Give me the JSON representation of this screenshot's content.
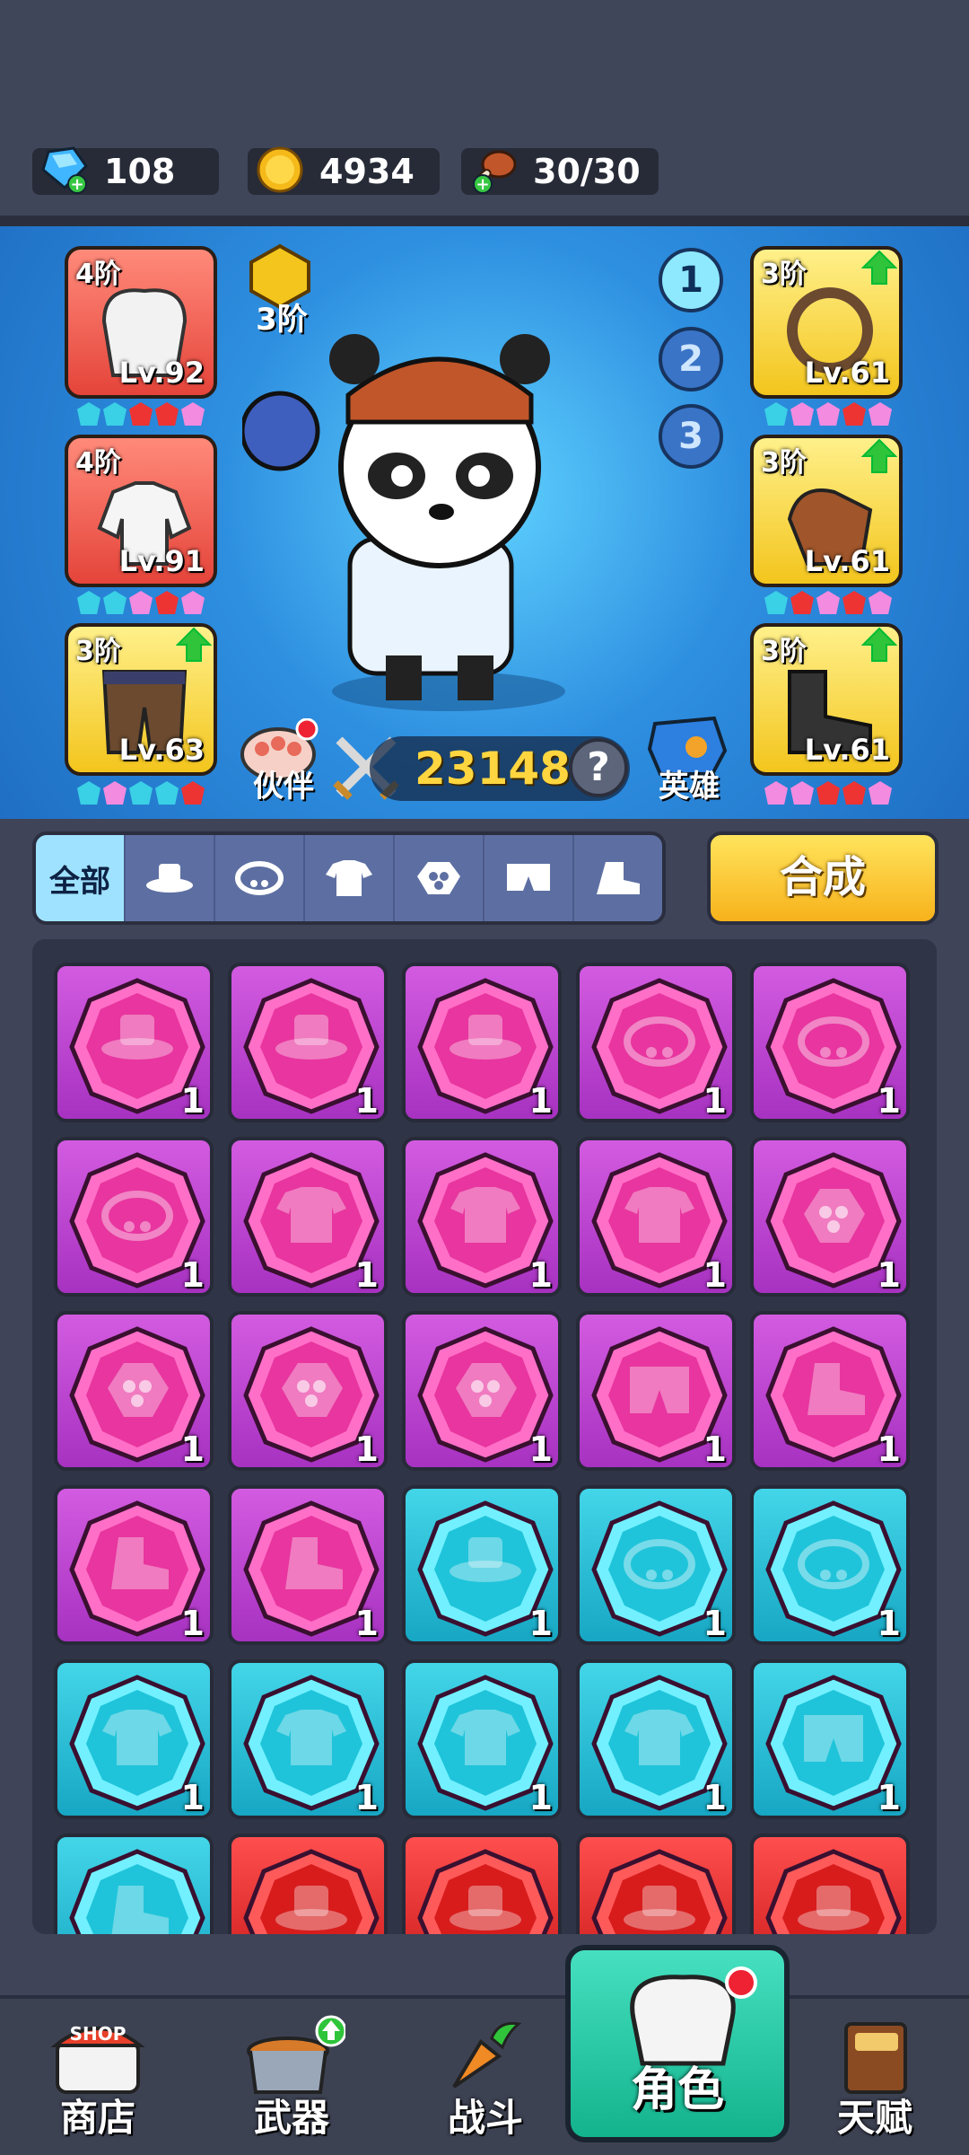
{
  "resources": {
    "gems": "108",
    "coins": "4934",
    "stamina": "30/30"
  },
  "left_slots": [
    {
      "tier": "4阶",
      "level": "Lv.92",
      "item": "chef-hat",
      "color": "red"
    },
    {
      "tier": "4阶",
      "level": "Lv.91",
      "item": "chef-jacket",
      "color": "red"
    },
    {
      "tier": "3阶",
      "level": "Lv.63",
      "item": "pants",
      "color": "yellow"
    }
  ],
  "right_slots": [
    {
      "tier": "3阶",
      "level": "Lv.61",
      "item": "necklace",
      "color": "yellow",
      "upgrade": true
    },
    {
      "tier": "3阶",
      "level": "Lv.61",
      "item": "gloves",
      "color": "yellow",
      "upgrade": true
    },
    {
      "tier": "3阶",
      "level": "Lv.61",
      "item": "boots",
      "color": "yellow",
      "upgrade": true
    }
  ],
  "loadouts": [
    "1",
    "2",
    "3"
  ],
  "hero_tier": "3阶",
  "power": "23148",
  "help": "?",
  "partner_label": "伙伴",
  "hero_label": "英雄",
  "tabs": {
    "all": "全部",
    "icons": [
      "hat-icon",
      "necklace-icon",
      "shirt-icon",
      "paw-icon",
      "pants-icon",
      "boot-icon"
    ]
  },
  "combine_label": "合成",
  "inventory": [
    {
      "color": "pink",
      "icon": "hat",
      "count": "1"
    },
    {
      "color": "pink",
      "icon": "hat",
      "count": "1"
    },
    {
      "color": "pink",
      "icon": "hat",
      "count": "1"
    },
    {
      "color": "pink",
      "icon": "necklace",
      "count": "1"
    },
    {
      "color": "pink",
      "icon": "necklace",
      "count": "1"
    },
    {
      "color": "pink",
      "icon": "necklace",
      "count": "1"
    },
    {
      "color": "pink",
      "icon": "shirt",
      "count": "1"
    },
    {
      "color": "pink",
      "icon": "shirt",
      "count": "1"
    },
    {
      "color": "pink",
      "icon": "shirt",
      "count": "1"
    },
    {
      "color": "pink",
      "icon": "paw",
      "count": "1"
    },
    {
      "color": "pink",
      "icon": "paw",
      "count": "1"
    },
    {
      "color": "pink",
      "icon": "paw",
      "count": "1"
    },
    {
      "color": "pink",
      "icon": "paw",
      "count": "1"
    },
    {
      "color": "pink",
      "icon": "pants",
      "count": "1"
    },
    {
      "color": "pink",
      "icon": "boot",
      "count": "1"
    },
    {
      "color": "pink",
      "icon": "boot",
      "count": "1"
    },
    {
      "color": "pink",
      "icon": "boot",
      "count": "1"
    },
    {
      "color": "cyan",
      "icon": "hat",
      "count": "1"
    },
    {
      "color": "cyan",
      "icon": "necklace",
      "count": "1"
    },
    {
      "color": "cyan",
      "icon": "necklace",
      "count": "1"
    },
    {
      "color": "cyan",
      "icon": "shirt",
      "count": "1"
    },
    {
      "color": "cyan",
      "icon": "shirt",
      "count": "1"
    },
    {
      "color": "cyan",
      "icon": "shirt",
      "count": "1"
    },
    {
      "color": "cyan",
      "icon": "shirt",
      "count": "1"
    },
    {
      "color": "cyan",
      "icon": "pants",
      "count": "1"
    },
    {
      "color": "cyan",
      "icon": "boot",
      "count": ""
    },
    {
      "color": "red",
      "icon": "hat",
      "count": ""
    },
    {
      "color": "red",
      "icon": "hat",
      "count": ""
    },
    {
      "color": "red",
      "icon": "hat",
      "count": ""
    },
    {
      "color": "red",
      "icon": "hat",
      "count": ""
    }
  ],
  "nav": {
    "shop": "商店",
    "shop_sign": "SHOP",
    "weapons": "武器",
    "battle": "战斗",
    "character": "角色",
    "talent": "天赋"
  }
}
